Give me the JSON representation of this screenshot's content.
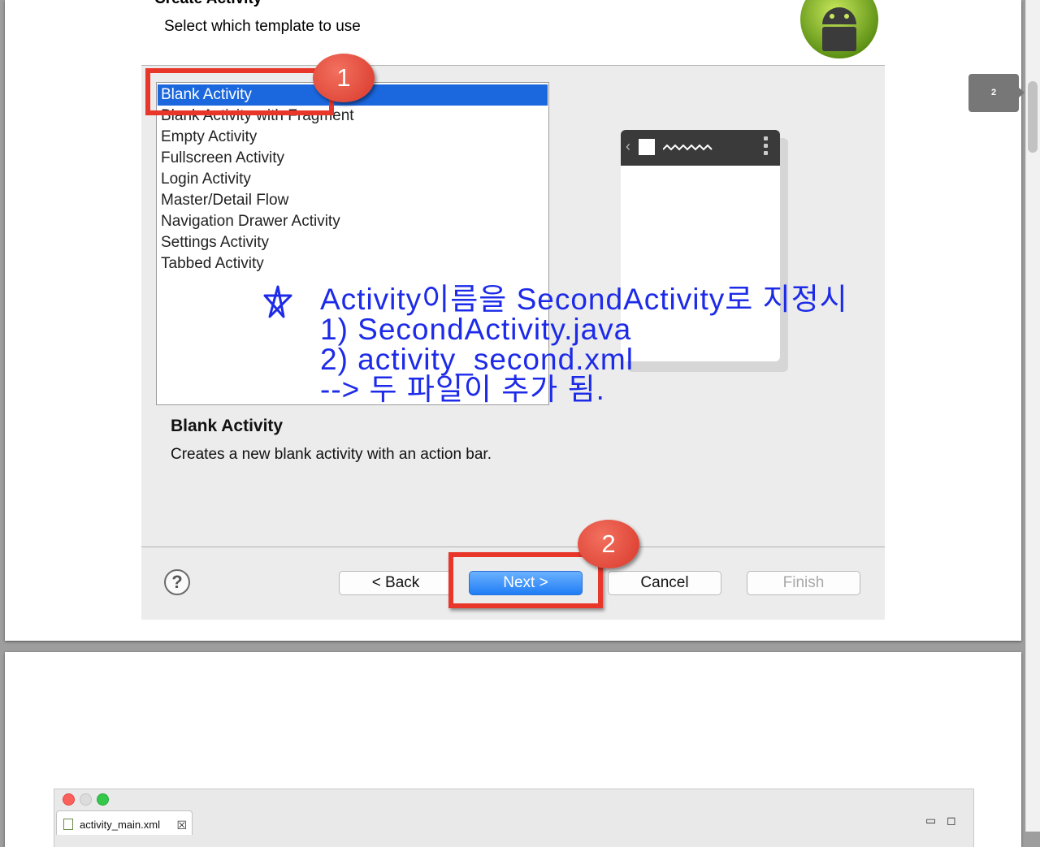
{
  "wizard": {
    "title": "Create Activity",
    "subtitle": "Select which template to use",
    "templates": [
      "Blank Activity",
      "Blank Activity with Fragment",
      "Empty Activity",
      "Fullscreen Activity",
      "Login Activity",
      "Master/Detail Flow",
      "Navigation Drawer Activity",
      "Settings Activity",
      "Tabbed Activity"
    ],
    "selected_template": "Blank Activity",
    "description_title": "Blank Activity",
    "description_text": "Creates a new blank activity with an action bar.",
    "help_label": "?",
    "buttons": {
      "back": "< Back",
      "next": "Next >",
      "cancel": "Cancel",
      "finish": "Finish"
    }
  },
  "annotations": {
    "badge1": "1",
    "badge2": "2",
    "note_lines": [
      "Activity이름을 SecondActivity로 지정시",
      "1) SecondActivity.java",
      "2) activity_second.xml",
      "--> 두 파일이 추가 됨."
    ]
  },
  "page_marker": "2",
  "editor": {
    "tab_label": "activity_main.xml",
    "close_glyph": "☒",
    "minimize_glyph": "▭",
    "maximize_glyph": "◻"
  },
  "colors": {
    "selection": "#1b67de",
    "annotation_red": "#e8362a",
    "note_blue": "#1d2be8",
    "primary_button": "#1f7ef5"
  }
}
